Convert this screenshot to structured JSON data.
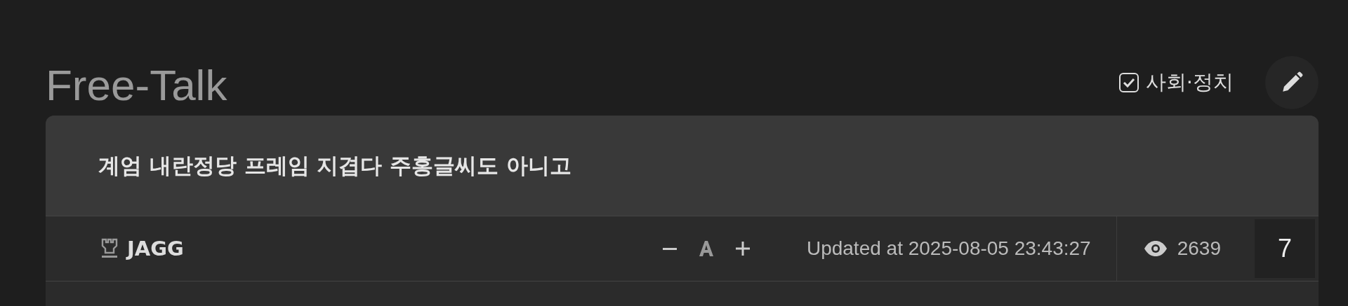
{
  "board": {
    "title": "Free-Talk"
  },
  "filter": {
    "label": "사회·정치",
    "checked": true
  },
  "post": {
    "title": "계엄 내란정당 프레임 지겹다 주홍글씨도 아니고",
    "author": "JAGG",
    "updated": "Updated at 2025-08-05 23:43:27",
    "views": "2639",
    "comments": "7"
  }
}
